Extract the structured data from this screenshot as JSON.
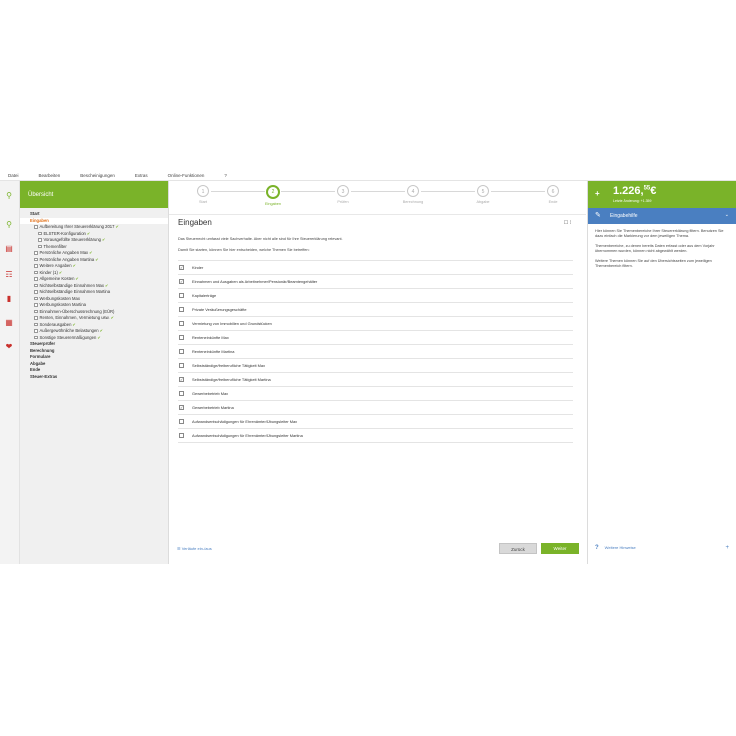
{
  "menu": [
    "Datei",
    "Bearbeiten",
    "Bescheinigungen",
    "Extras",
    "Online-Funktionen",
    "?"
  ],
  "nav": {
    "header": "Übersicht",
    "items": [
      {
        "label": "Start",
        "level": 0,
        "bold": true
      },
      {
        "label": "Eingaben",
        "level": 0,
        "active": true
      },
      {
        "label": "Aufbereitung Ihrer Steuererklärung 2017",
        "level": 1,
        "check": true
      },
      {
        "label": "ELSTER-Konfiguration",
        "level": 2,
        "check": true
      },
      {
        "label": "Vorausgefüllte Steuererklärung",
        "level": 2,
        "check": true
      },
      {
        "label": "Themenfilter",
        "level": 2
      },
      {
        "label": "Persönliche Angaben Max",
        "level": 1,
        "check": true
      },
      {
        "label": "Persönliche Angaben Martina",
        "level": 1,
        "check": true
      },
      {
        "label": "Weitere Angaben",
        "level": 1,
        "check": true
      },
      {
        "label": "Kinder (1)",
        "level": 1,
        "check": true
      },
      {
        "label": "Allgemeine Kosten",
        "level": 1,
        "check": true
      },
      {
        "label": "Nichtselbständige Einnahmen Max",
        "level": 1,
        "check": true
      },
      {
        "label": "Nichtselbständige Einnahmen Martina",
        "level": 1
      },
      {
        "label": "Werbungskosten Max",
        "level": 1
      },
      {
        "label": "Werbungskosten Martina",
        "level": 1
      },
      {
        "label": "Einnahmen-Überschussrechnung (EÜR)",
        "level": 1
      },
      {
        "label": "Renten, Einnahmen, Vermietung usw.",
        "level": 1,
        "check": true
      },
      {
        "label": "Sonderausgaben",
        "level": 1,
        "check": true
      },
      {
        "label": "Außergewöhnliche Belastungen",
        "level": 1,
        "check": true
      },
      {
        "label": "Sonstige Steuerermäßigungen",
        "level": 1,
        "check": true
      },
      {
        "label": "Steuerprüfer",
        "level": 0,
        "bold": true
      },
      {
        "label": "Berechnung",
        "level": 0,
        "bold": true
      },
      {
        "label": "Formulare",
        "level": 0,
        "bold": true
      },
      {
        "label": "Abgabe",
        "level": 0,
        "bold": true
      },
      {
        "label": "Ende",
        "level": 0,
        "bold": true
      },
      {
        "label": "Steuer-Extras",
        "level": 0,
        "bold": true
      }
    ]
  },
  "steps": [
    {
      "num": "1",
      "label": "Start"
    },
    {
      "num": "2",
      "label": "Eingaben",
      "active": true
    },
    {
      "num": "3",
      "label": "Prüfen"
    },
    {
      "num": "4",
      "label": "Berechnung"
    },
    {
      "num": "5",
      "label": "Abgabe"
    },
    {
      "num": "6",
      "label": "Ende"
    }
  ],
  "main": {
    "title": "Eingaben",
    "title_options": "☐ ⁞",
    "intro1": "Das Steuerrecht umfasst viele Sachverhalte. Aber nicht alle sind für Ihre Steuererklärung relevant.",
    "intro2": "Damit Sie starten, können Sie hier entscheiden, welche Themen Sie betreffen:",
    "topics": [
      {
        "label": "Kinder",
        "checked": true
      },
      {
        "label": "Einnahmen und Ausgaben als Arbeitnehmer/Pensionär/Beamtengehälter",
        "checked": true
      },
      {
        "label": "Kapitalerträge",
        "checked": false
      },
      {
        "label": "Private Veräußerungsgeschäfte",
        "checked": false
      },
      {
        "label": "Vermietung von Immobilien und Grundstücken",
        "checked": false
      },
      {
        "label": "Renteneinkünfte Max",
        "checked": false
      },
      {
        "label": "Renteneinkünfte Martina",
        "checked": false
      },
      {
        "label": "Selbstständige/freiberufliche Tätigkeit Max",
        "checked": false
      },
      {
        "label": "Selbstständige/freiberufliche Tätigkeit Martina",
        "checked": true
      },
      {
        "label": "Gewerbebetrieb Max",
        "checked": false
      },
      {
        "label": "Gewerbebetrieb Martina",
        "checked": true
      },
      {
        "label": "Aufwandsentschädigungen für Ehrenämter/Übungsleiter Max",
        "checked": false
      },
      {
        "label": "Aufwandsentschädigungen für Ehrenämter/Übungsleiter Martina",
        "checked": false
      }
    ],
    "footer_link": "☰ Verläufe ein-/aus",
    "back_label": "Zurück",
    "next_label": "Weiter"
  },
  "right": {
    "amount_sign": "+",
    "amount": "1.226,",
    "amount_cents": "55",
    "amount_currency": "€",
    "amount_sub": "Letzte Änderung: +1.359",
    "help_title": "Eingabehilfe",
    "help_p1": "Hier können Sie Themenbereiche Ihrer Steuererklärung filtern. Benutzen Sie dazu einfach die Markierung vor dem jeweiligen Thema.",
    "help_p2": "Themenbereiche, zu denen bereits Daten erfasst oder aus dem Vorjahr übernommen wurden, können nicht abgewählt werden.",
    "help_p3": "Weitere Themen können Sie auf den Übersichtsseiten zum jeweiligen Themenbereich filtern.",
    "more_help": "Weitere Hinweise"
  },
  "colors": {
    "accent": "#7ab329",
    "blue": "#4a7fc1",
    "active_nav": "#e2721b"
  }
}
